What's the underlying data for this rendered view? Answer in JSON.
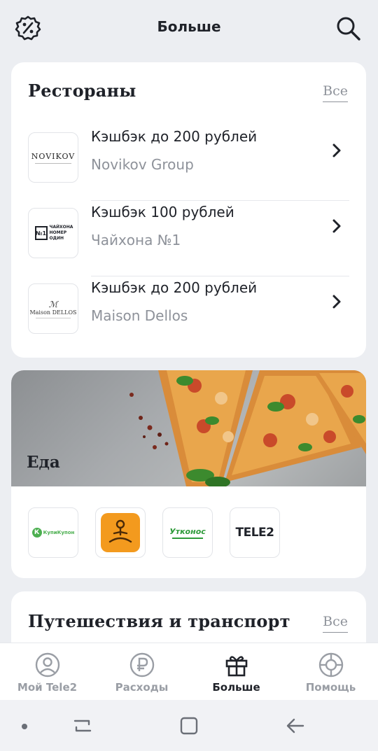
{
  "header": {
    "title": "Больше",
    "left_icon": "discount-badge-icon",
    "right_icon": "search-icon"
  },
  "restaurants": {
    "title": "Рестораны",
    "all_label": "Все",
    "items": [
      {
        "cashback": "Кэшбэк до 200 рублей",
        "name": "Novikov Group",
        "logo_text": "NOVIKOV"
      },
      {
        "cashback": "Кэшбэк 100 рублей",
        "name": "Чайхона №1",
        "logo_text": "ЧАЙХОНА НОМЕР ОДИН"
      },
      {
        "cashback": "Кэшбэк до 200 рублей",
        "name": "Maison Dellos",
        "logo_text": "Maison DELLOS"
      }
    ]
  },
  "food": {
    "title": "Еда",
    "partners": [
      {
        "logo_text": "КупиКупон",
        "color": "#4caf50"
      },
      {
        "logo_text": "",
        "color": "#f39a1e"
      },
      {
        "logo_text": "Утконос",
        "color": "#2e9b3a"
      },
      {
        "logo_text": "TELE2",
        "color": "#1f2229"
      }
    ]
  },
  "travel": {
    "title": "Путешествия и транспорт",
    "all_label": "Все"
  },
  "tabbar": {
    "tabs": [
      {
        "label": "Мой Tele2",
        "icon": "profile-icon",
        "active": false
      },
      {
        "label": "Расходы",
        "icon": "ruble-icon",
        "active": false
      },
      {
        "label": "Больше",
        "icon": "gift-icon",
        "active": true
      },
      {
        "label": "Помощь",
        "icon": "lifebuoy-icon",
        "active": false
      }
    ]
  },
  "colors": {
    "background": "#eceef2",
    "text": "#1f2229",
    "secondary_text": "#8e929a"
  }
}
